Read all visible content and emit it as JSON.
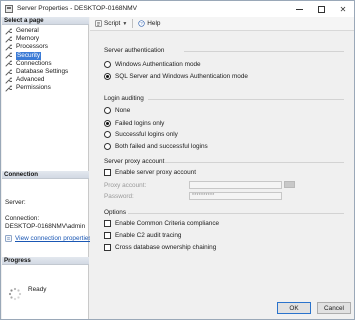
{
  "window": {
    "title": "Server Properties - DESKTOP-0168NMV"
  },
  "left_pane": {
    "select_page_header": "Select a page",
    "pages": [
      {
        "label": "General"
      },
      {
        "label": "Memory"
      },
      {
        "label": "Processors"
      },
      {
        "label": "Security",
        "selected": true
      },
      {
        "label": "Connections"
      },
      {
        "label": "Database Settings"
      },
      {
        "label": "Advanced"
      },
      {
        "label": "Permissions"
      }
    ],
    "connection_header": "Connection",
    "server_label": "Server:",
    "connection_label": "Connection:",
    "connection_value": "DESKTOP-0168NMV\\admin",
    "view_properties_link": "View connection properties",
    "progress_header": "Progress",
    "progress_status": "Ready"
  },
  "toolbar": {
    "script_label": "Script",
    "help_label": "Help"
  },
  "server_auth": {
    "title": "Server authentication",
    "options": [
      {
        "label": "Windows Authentication mode",
        "selected": false
      },
      {
        "label": "SQL Server and Windows Authentication mode",
        "selected": true
      }
    ]
  },
  "login_auditing": {
    "title": "Login auditing",
    "options": [
      {
        "label": "None",
        "selected": false
      },
      {
        "label": "Failed logins only",
        "selected": true
      },
      {
        "label": "Successful logins only",
        "selected": false
      },
      {
        "label": "Both failed and successful logins",
        "selected": false
      }
    ]
  },
  "proxy": {
    "title": "Server proxy account",
    "enable_label": "Enable server proxy account",
    "enabled": false,
    "account_label": "Proxy account:",
    "account_value": "",
    "password_label": "Password:",
    "password_value": "**********"
  },
  "options": {
    "title": "Options",
    "items": [
      {
        "label": "Enable Common Criteria compliance",
        "checked": false
      },
      {
        "label": "Enable C2 audit tracing",
        "checked": false
      },
      {
        "label": "Cross database ownership chaining",
        "checked": false
      }
    ]
  },
  "footer": {
    "ok_label": "OK",
    "cancel_label": "Cancel"
  },
  "colors": {
    "selection": "#3b7bd6",
    "link": "#1a57b4",
    "ok_border": "#2a73cc"
  }
}
